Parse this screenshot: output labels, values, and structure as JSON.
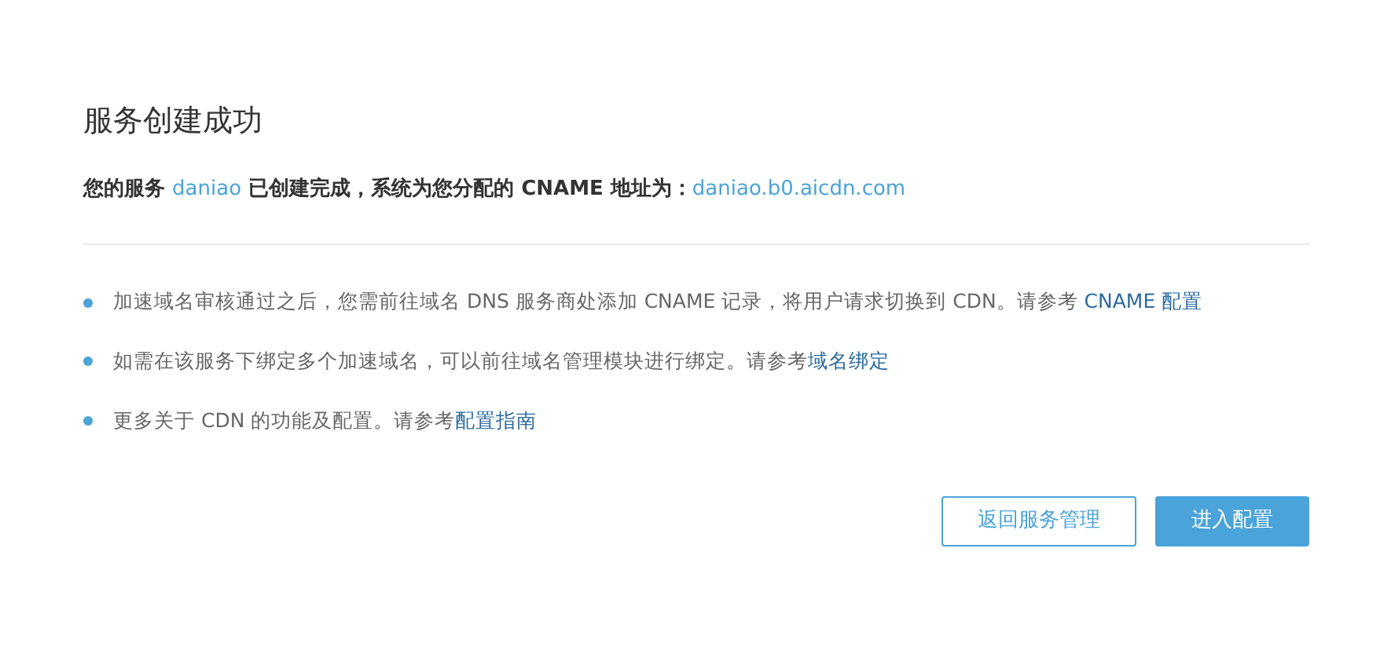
{
  "title": "服务创建成功",
  "summary": {
    "prefix": "您的服务",
    "service": "daniao",
    "middle": "已创建完成，系统为您分配的 CNAME 地址为：",
    "cname": "daniao.b0.aicdn.com"
  },
  "tips": [
    {
      "text": "加速域名审核通过之后，您需前往域名 DNS 服务商处添加 CNAME 记录，将用户请求切换到 CDN。请参考 ",
      "link": "CNAME 配置"
    },
    {
      "text": "如需在该服务下绑定多个加速域名，可以前往域名管理模块进行绑定。请参考",
      "link": "域名绑定"
    },
    {
      "text": "更多关于 CDN 的功能及配置。请参考",
      "link": "配置指南"
    }
  ],
  "buttons": [
    {
      "label": "返回服务管理",
      "kind": "outline"
    },
    {
      "label": "进入配置",
      "kind": "primary"
    }
  ]
}
